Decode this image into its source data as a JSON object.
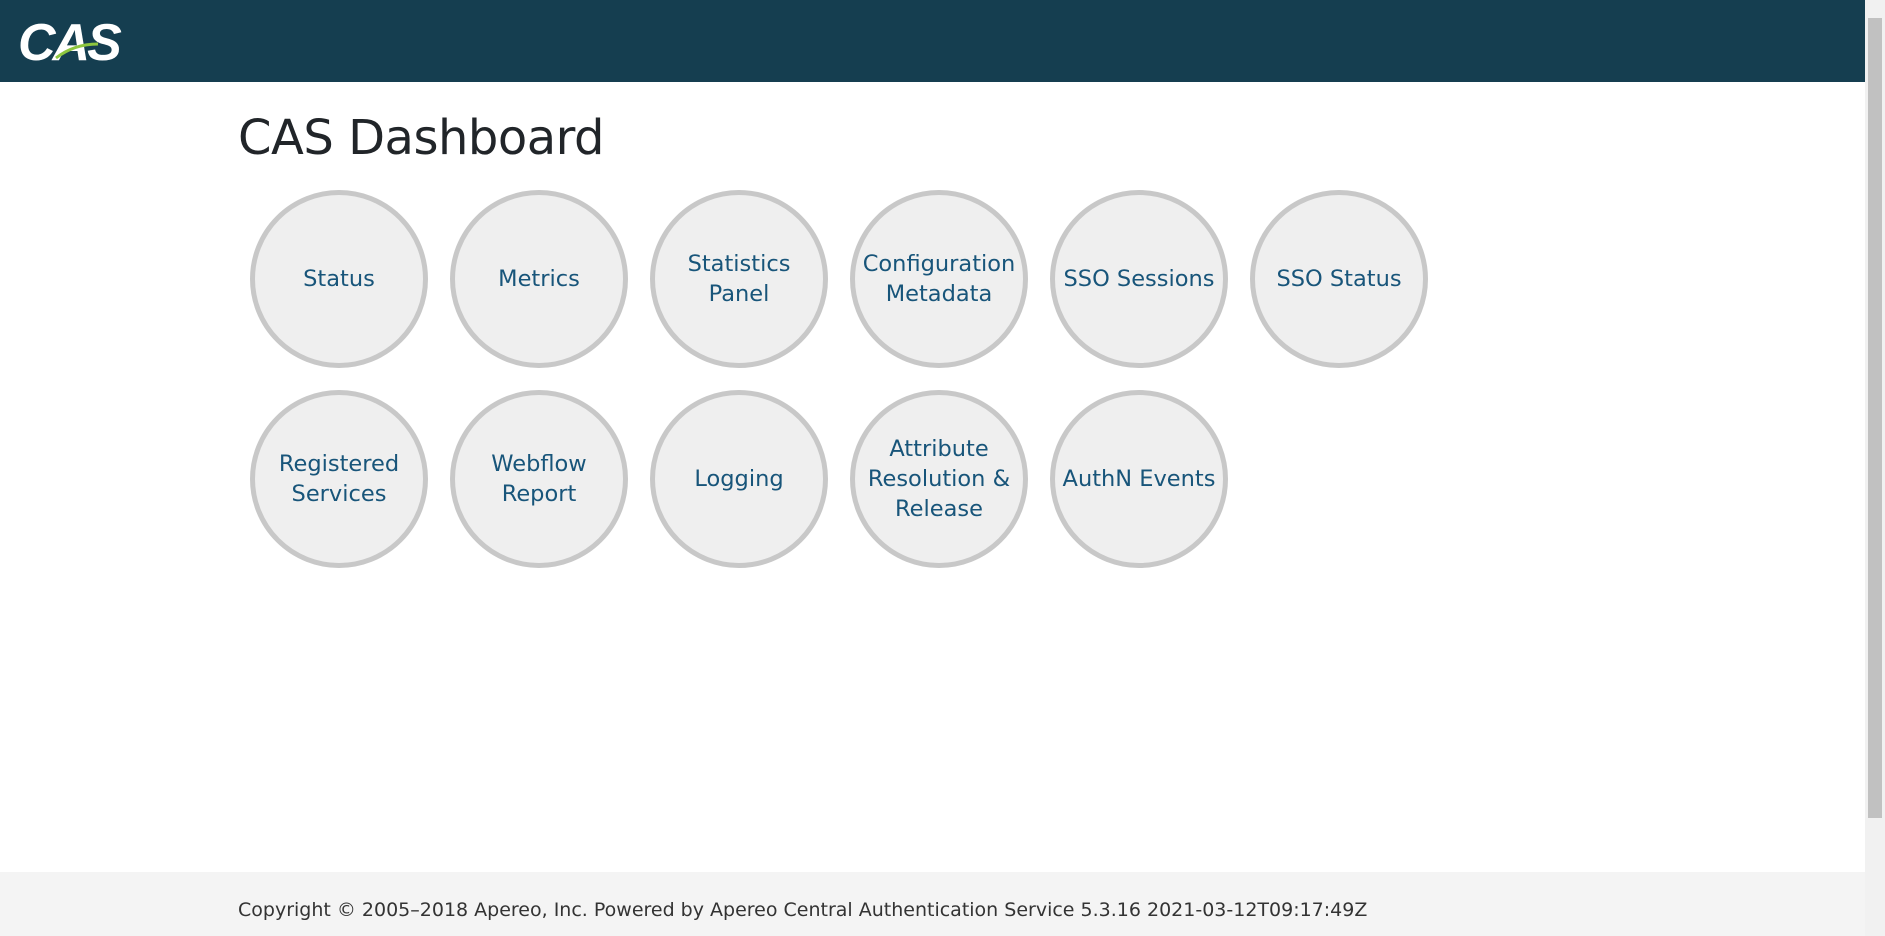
{
  "header": {
    "logo_text": "CAS",
    "background_color": "#153e50",
    "accent_color": "#8dc63f"
  },
  "page": {
    "title": "CAS Dashboard"
  },
  "tiles": [
    {
      "label": "Status"
    },
    {
      "label": "Metrics"
    },
    {
      "label": "Statistics Panel"
    },
    {
      "label": "Configuration Metadata"
    },
    {
      "label": "SSO Sessions"
    },
    {
      "label": "SSO Status"
    },
    {
      "label": "Registered Services"
    },
    {
      "label": "Webflow Report"
    },
    {
      "label": "Logging"
    },
    {
      "label": "Attribute Resolution & Release"
    },
    {
      "label": "AuthN Events"
    }
  ],
  "footer": {
    "text": "Copyright © 2005–2018 Apereo, Inc. Powered by Apereo Central Authentication Service 5.3.16 2021-03-12T09:17:49Z"
  },
  "colors": {
    "tile_text": "#18557a",
    "tile_fill": "#efefef",
    "tile_border": "#c8c8c8"
  }
}
